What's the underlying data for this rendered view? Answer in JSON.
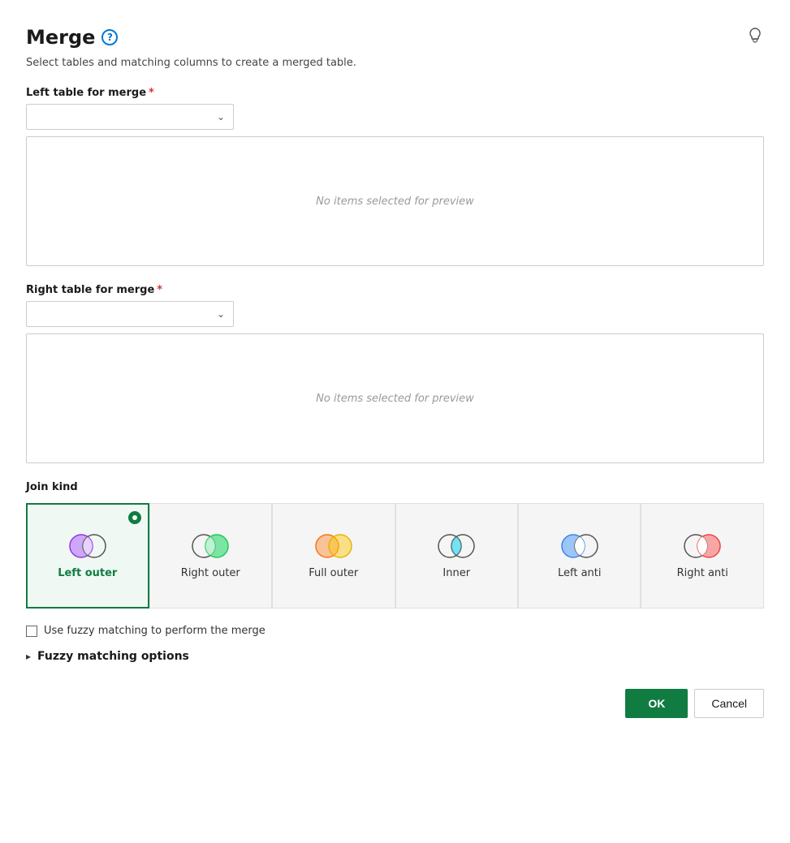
{
  "page": {
    "title": "Merge",
    "subtitle": "Select tables and matching columns to create a merged table.",
    "help_icon_label": "?",
    "lightbulb_icon": "💡"
  },
  "left_table": {
    "label": "Left table for merge",
    "required": true,
    "placeholder": "",
    "preview_empty": "No items selected for preview"
  },
  "right_table": {
    "label": "Right table for merge",
    "required": true,
    "placeholder": "",
    "preview_empty": "No items selected for preview"
  },
  "join_kind": {
    "label": "Join kind",
    "options": [
      {
        "id": "left-outer",
        "label": "Left outer",
        "selected": true,
        "venn": "left-outer"
      },
      {
        "id": "right-outer",
        "label": "Right outer",
        "selected": false,
        "venn": "right-outer"
      },
      {
        "id": "full-outer",
        "label": "Full outer",
        "selected": false,
        "venn": "full-outer"
      },
      {
        "id": "inner",
        "label": "Inner",
        "selected": false,
        "venn": "inner"
      },
      {
        "id": "left-anti",
        "label": "Left anti",
        "selected": false,
        "venn": "left-anti"
      },
      {
        "id": "right-anti",
        "label": "Right anti",
        "selected": false,
        "venn": "right-anti"
      }
    ]
  },
  "fuzzy": {
    "checkbox_label": "Use fuzzy matching to perform the merge",
    "options_label": "Fuzzy matching options"
  },
  "buttons": {
    "ok": "OK",
    "cancel": "Cancel"
  }
}
